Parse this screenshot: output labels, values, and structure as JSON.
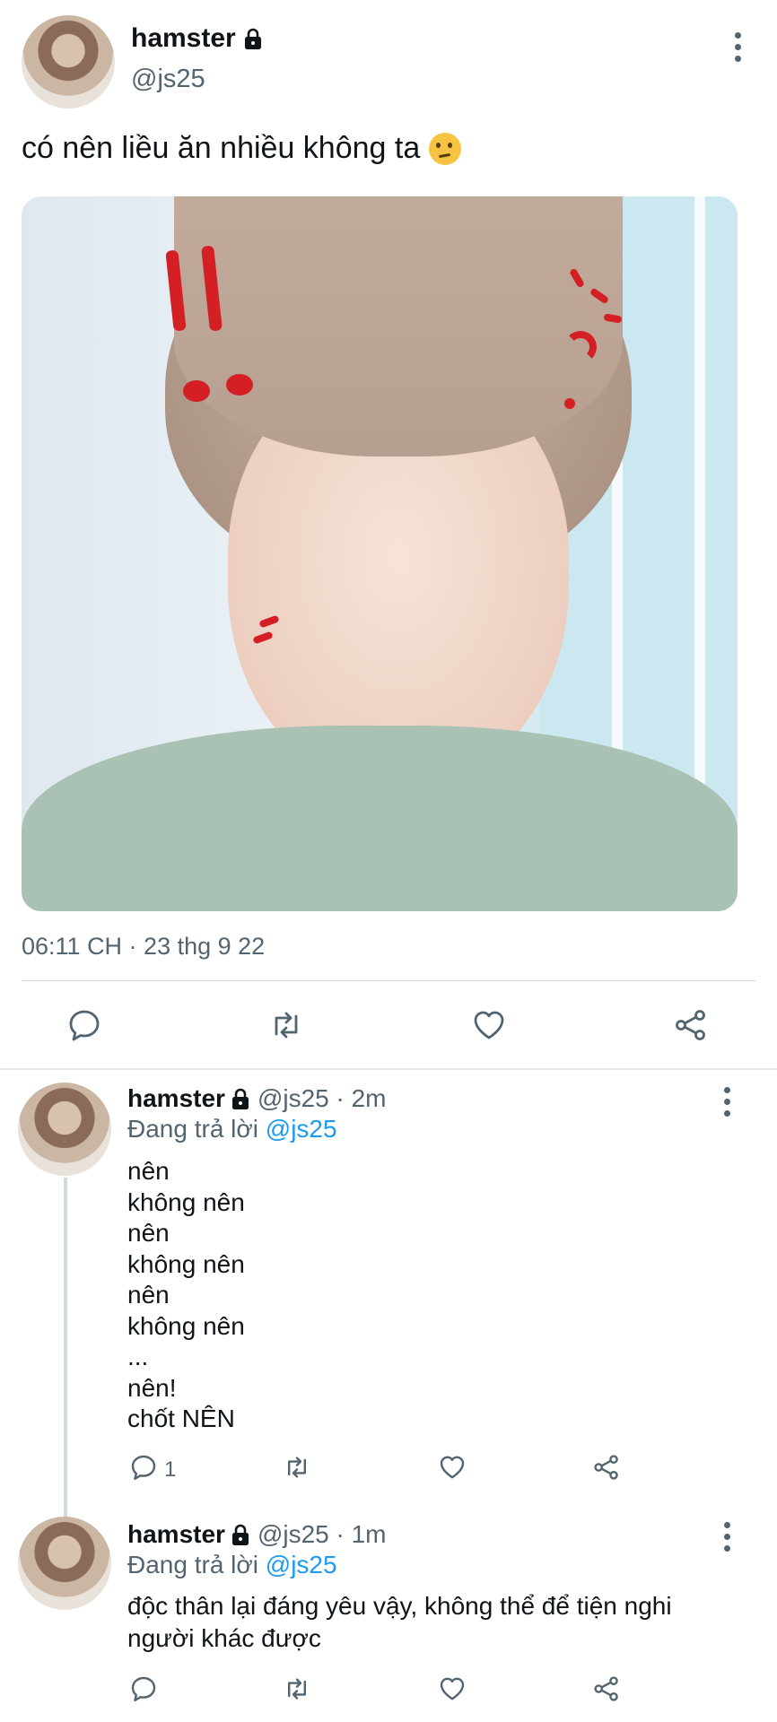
{
  "tweet": {
    "author_name": "hamster",
    "author_handle": "@js25",
    "text": "có nên liều ăn nhiều không ta",
    "timestamp": "06:11 CH · 23 thg 9 22"
  },
  "replies": [
    {
      "author_name": "hamster",
      "meta": "@js25 · 2m",
      "replying_prefix": "Đang trả lời",
      "replying_to": "@js25",
      "lines": [
        "nên",
        "không nên",
        "nên",
        "không nên",
        "nên",
        "không nên",
        "...",
        "nên!",
        "chốt NÊN"
      ],
      "reply_count": "1"
    },
    {
      "author_name": "hamster",
      "meta": "@js25 · 1m",
      "replying_prefix": "Đang trả lời",
      "replying_to": "@js25",
      "text": "độc thân lại đáng yêu vậy, không thể để tiện nghi người khác được"
    }
  ],
  "colors": {
    "text_primary": "#0f1419",
    "text_secondary": "#536471",
    "mention_blue": "#1d9bf0",
    "divider": "#d9dde1"
  },
  "icons": [
    "lock-icon",
    "more-vertical-icon",
    "thinking-face-icon",
    "reply-icon",
    "retweet-icon",
    "like-icon",
    "share-icon"
  ]
}
